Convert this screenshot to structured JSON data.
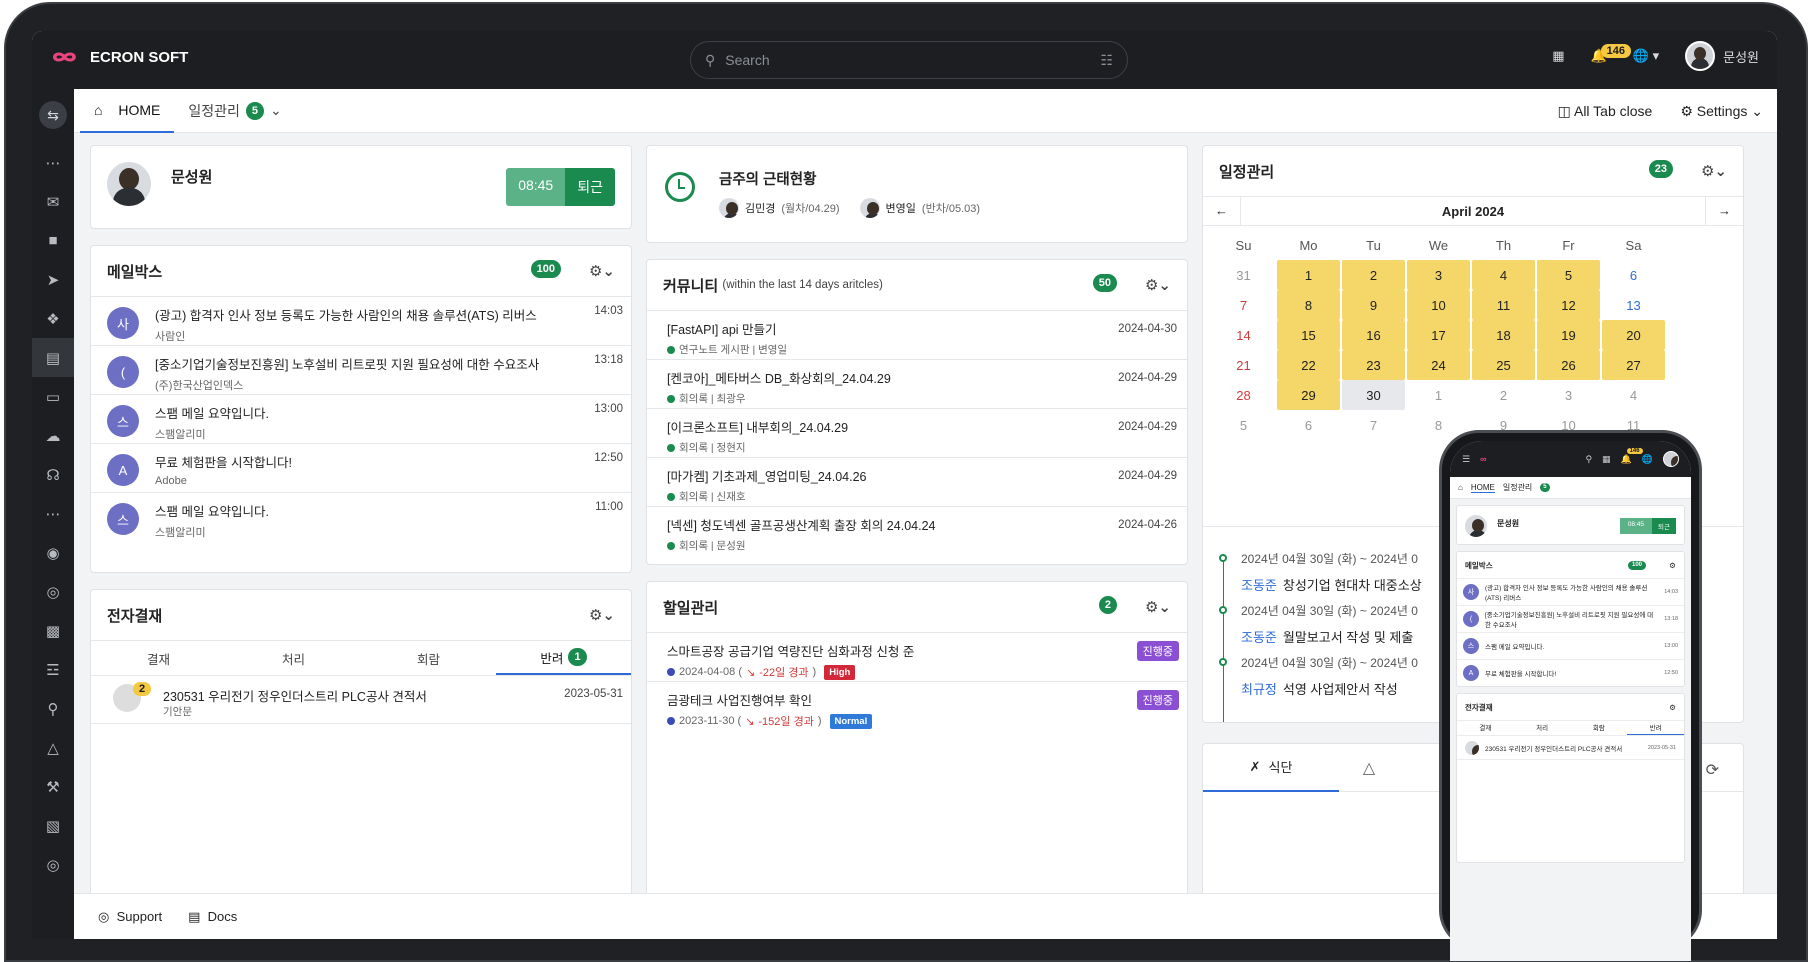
{
  "app": {
    "name": "ECRON SOFT"
  },
  "search": {
    "placeholder": "Search"
  },
  "topbar": {
    "notifications": "146",
    "user": "문성원"
  },
  "tabs": {
    "home": "HOME",
    "schedule": "일정관리",
    "schedule_count": "5",
    "all_close": "All Tab close",
    "settings": "Settings"
  },
  "profile": {
    "name": "문성원",
    "time": "08:45",
    "leave": "퇴근"
  },
  "attendance": {
    "title": "금주의 근태현황",
    "p1_name": "김민경",
    "p1_note": "(월차/04.29)",
    "p2_name": "변영일",
    "p2_note": "(반차/05.03)"
  },
  "mailbox": {
    "title": "메일박스",
    "count": "100",
    "items": [
      {
        "initial": "사",
        "title": "(광고) 합격자 인사 정보 등록도 가능한 사람인의 채용 솔루션(ATS) 리버스",
        "sender": "사람인",
        "time": "14:03"
      },
      {
        "initial": "(",
        "title": "[중소기업기술정보진흥원] 노후설비 리트로핏 지원 필요성에 대한 수요조사",
        "sender": "(주)한국산업인덱스",
        "time": "13:18"
      },
      {
        "initial": "스",
        "title": "스팸 메일 요약입니다.",
        "sender": "스팸알리미",
        "time": "13:00"
      },
      {
        "initial": "A",
        "title": "무료 체험판을 시작합니다!",
        "sender": "Adobe",
        "time": "12:50"
      },
      {
        "initial": "스",
        "title": "스팸 메일 요약입니다.",
        "sender": "스팸알리미",
        "time": "11:00"
      }
    ]
  },
  "community": {
    "title": "커뮤니티",
    "subtitle": "(within the last 14 days aritcles)",
    "count": "50",
    "items": [
      {
        "title": "[FastAPI] api 만들기",
        "meta": "연구노트 게시판 | 변영일",
        "date": "2024-04-30"
      },
      {
        "title": "[켄코아]_메타버스 DB_화상회의_24.04.29",
        "meta": "회의록 | 최광우",
        "date": "2024-04-29"
      },
      {
        "title": "[이크론소프트] 내부회의_24.04.29",
        "meta": "회의록 | 정현지",
        "date": "2024-04-29"
      },
      {
        "title": "[마가켐] 기초과제_영업미팅_24.04.26",
        "meta": "회의록 | 신재호",
        "date": "2024-04-29"
      },
      {
        "title": "[넥센] 청도넥센 골프공생산계획 출장 회의 24.04.24",
        "meta": "회의록 | 문성원",
        "date": "2024-04-26"
      }
    ]
  },
  "approval": {
    "title": "전자결재",
    "tabs": [
      "결재",
      "처리",
      "회람",
      "반려"
    ],
    "reject_count": "1",
    "item": {
      "badge": "2",
      "title": "230531 우리전기 정우인더스트리 PLC공사 견적서",
      "author": "기안문",
      "date": "2023-05-31"
    }
  },
  "todo": {
    "title": "할일관리",
    "count": "2",
    "items": [
      {
        "title": "스마트공장 공급기업 역량진단 심화과정 신청 준",
        "date": "2024-04-08 (",
        "overdue": "-22일 경과",
        "close": ")",
        "priority": "High",
        "status": "진행중"
      },
      {
        "title": "금광테크 사업진행여부 확인",
        "date": "2023-11-30 (",
        "overdue": "-152일 경과",
        "close": ")",
        "priority": "Normal",
        "status": "진행중"
      }
    ]
  },
  "calendar": {
    "title": "일정관리",
    "count": "23",
    "month": "April 2024",
    "dow": [
      "Su",
      "Mo",
      "Tu",
      "We",
      "Th",
      "Fr",
      "Sa"
    ],
    "days": [
      "31",
      "1",
      "2",
      "3",
      "4",
      "5",
      "6",
      "7",
      "8",
      "9",
      "10",
      "11",
      "12",
      "13",
      "14",
      "15",
      "16",
      "17",
      "18",
      "19",
      "20",
      "21",
      "22",
      "23",
      "24",
      "25",
      "26",
      "27",
      "28",
      "29",
      "30",
      "1",
      "2",
      "3",
      "4",
      "5",
      "6",
      "7",
      "8",
      "9",
      "10",
      "11"
    ]
  },
  "timeline": [
    {
      "date": "2024년 04월 30일 (화) ~ 2024년 0",
      "name": "조동준",
      "task": "창성기업 현대차 대중소상"
    },
    {
      "date": "2024년 04월 30일 (화) ~ 2024년 0",
      "name": "조동준",
      "task": "월말보고서 작성 및 제출"
    },
    {
      "date": "2024년 04월 30일 (화) ~ 2024년 0",
      "name": "최규정",
      "task": "석영 사업제안서 작성"
    }
  ],
  "meal": {
    "tab": "식단"
  },
  "footer": {
    "support": "Support",
    "docs": "Docs"
  },
  "colors": {
    "accent": "#2f6bd8",
    "green": "#1a8a4f",
    "highlight": "#f5d668"
  }
}
